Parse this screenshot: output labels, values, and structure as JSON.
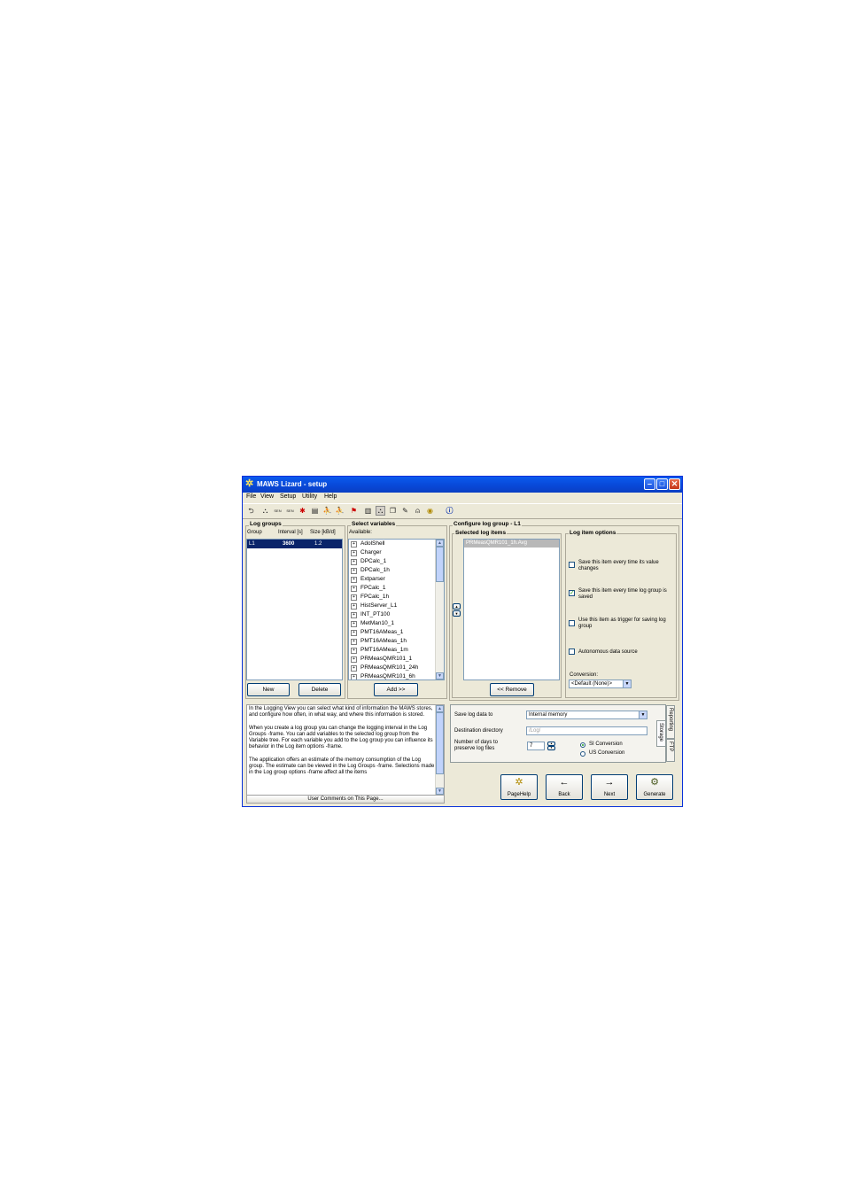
{
  "window": {
    "title": "MAWS Lizard - setup",
    "icon": "lizard-icon",
    "buttons": [
      "minimize-icon",
      "maximize-icon",
      "close-icon"
    ]
  },
  "menu": [
    "File",
    "View",
    "Setup",
    "Utility",
    "Help"
  ],
  "toolbar": {
    "icons": [
      "back-arrow-icon",
      "network-icon",
      "sensor-icon",
      "sensor-icon",
      "calc-icon",
      "display-icon",
      "run-icon",
      "run-icon",
      "flag-icon",
      "meter-icon",
      "network-icon",
      "window-icon",
      "pen-icon",
      "bell-icon",
      "globe-icon",
      "info-icon"
    ],
    "sensor_label": "SEN"
  },
  "log_groups": {
    "title": "Log groups",
    "columns": [
      "Group",
      "Interval [s]",
      "Size [kB/d]"
    ],
    "rows": [
      {
        "group": "L1",
        "interval": "3600",
        "size": "1.2"
      }
    ],
    "new_label": "New",
    "delete_label": "Delete"
  },
  "select_variables": {
    "title": "Select variables",
    "available_label": "Available:",
    "items": [
      "AdolShell",
      "Charger",
      "DPCalc_1",
      "DPCalc_1h",
      "Extparser",
      "FPCalc_1",
      "FPCalc_1h",
      "HistServer_L1",
      "INT_PT100",
      "MetMan10_1",
      "PMT16AMeas_1",
      "PMT16AMeas_1h",
      "PMT16AMeas_1m",
      "PRMeasQMR101_1",
      "PRMeasQMR101_24h",
      "PRMeasQMR101_6h"
    ],
    "add_label": "Add >>"
  },
  "configure": {
    "title": "Configure log group - L1",
    "selected_title": "Selected log items",
    "selected_items": [
      "PRMeasQMR101_1h.Avg"
    ],
    "remove_label": "<< Remove"
  },
  "options": {
    "title": "Log item options",
    "checkboxes": [
      {
        "label": "Save this item every time its value changes",
        "checked": false
      },
      {
        "label": "Save this item every time log group is saved",
        "checked": true
      },
      {
        "label": "Use this item as trigger for saving log group",
        "checked": false
      },
      {
        "label": "Autonomous data source",
        "checked": false
      }
    ],
    "conversion_label": "Conversion:",
    "conversion_value": "<Default (None)>"
  },
  "help": {
    "paragraphs": [
      "In the Logging View you can select what kind of information the MAWS stores, and configure how often, in what way, and where this information is stored.",
      "When you create a log group you can change the logging interval in the Log Groups -frame. You can add variables to the selected log group from the Variable tree. For each variable you add to the Log group you can influence its behavior in the Log item options -frame.",
      "The application offers an estimate of the memory consumption of the Log group. The estimate can be viewed in the Log Groups -frame. Selections made in the Log group options -frame affect all the items"
    ],
    "comments_label": "User Comments on This Page..."
  },
  "storage": {
    "save_label": "Save log data to",
    "save_value": "Internal memory",
    "dest_label": "Destination directory",
    "dest_value": "/Log/",
    "days_label": "Number of days to preserve log files",
    "days_value": "7",
    "radios": [
      {
        "label": "SI Conversion",
        "selected": true
      },
      {
        "label": "US Conversion",
        "selected": false
      }
    ],
    "tabs": [
      "Reporting",
      "Storage",
      "FTP"
    ]
  },
  "nav": {
    "pagehelp": "PageHelp",
    "back": "Back",
    "next": "Next",
    "generate": "Generate"
  }
}
